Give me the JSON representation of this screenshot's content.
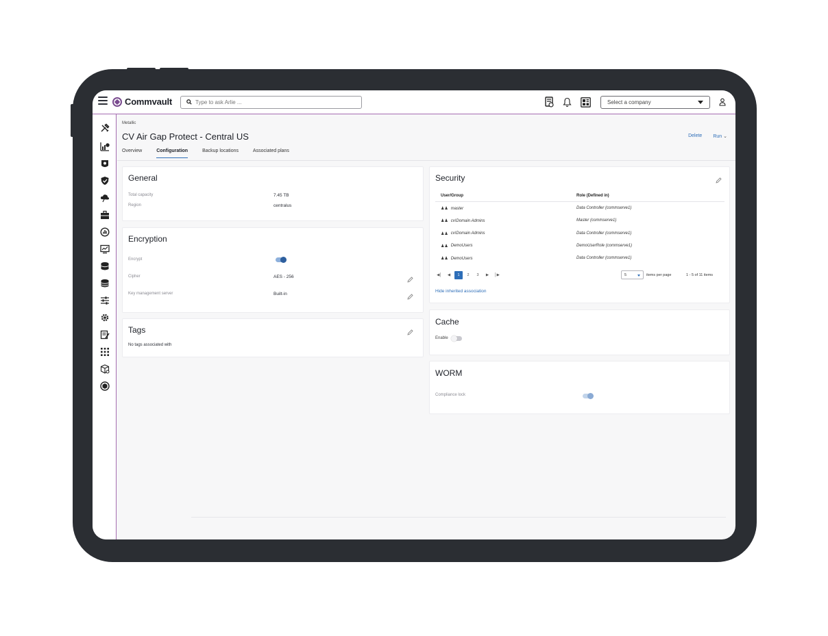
{
  "header": {
    "brand": "Commvault",
    "search_placeholder": "Type to ask Arlie ...",
    "company_select": "Select a company",
    "icons": [
      "hamburger-icon",
      "commvault-logo-icon",
      "search-icon",
      "report-icon",
      "bell-icon",
      "dashboard-icon",
      "user-icon"
    ]
  },
  "sidebar": {
    "items": [
      "tools-icon",
      "reports-icon",
      "guard-icon",
      "shield-icon",
      "cloud-icon",
      "briefcase-icon",
      "activity-icon",
      "monitor-icon",
      "storage-icon",
      "database-icon",
      "sliders-icon",
      "gear-icon",
      "jobs-icon",
      "apps-icon",
      "package-icon",
      "hub-icon"
    ]
  },
  "page": {
    "breadcrumb": "Metallic",
    "title": "CV Air Gap Protect - Central US",
    "actions": {
      "delete": "Delete",
      "run": "Run"
    },
    "tabs": [
      "Overview",
      "Configuration",
      "Backup locations",
      "Associated plans"
    ],
    "active_tab": "Configuration"
  },
  "general": {
    "title": "General",
    "rows": [
      {
        "label": "Total capacity",
        "value": "7.45 TB"
      },
      {
        "label": "Region",
        "value": "centralus"
      }
    ]
  },
  "encryption": {
    "title": "Encryption",
    "encrypt_label": "Encrypt",
    "encrypt_on": true,
    "cipher_label": "Cipher",
    "cipher_value": "AES - 256",
    "kms_label": "Key management server",
    "kms_value": "Built-in"
  },
  "tags": {
    "title": "Tags",
    "empty_text": "No tags associated with"
  },
  "security": {
    "title": "Security",
    "columns": [
      "User/Group",
      "Role (Defined in)"
    ],
    "rows": [
      {
        "user": "master",
        "role": "Data Controller (commserve1)"
      },
      {
        "user": "cv\\Domain Admins",
        "role": "Master (commserve1)"
      },
      {
        "user": "cv\\Domain Admins",
        "role": "Data Controller (commserve1)"
      },
      {
        "user": "DemoUsers",
        "role": "DemoUserRole (commserve1)"
      },
      {
        "user": "DemoUsers",
        "role": "Data Controller (commserve1)"
      }
    ],
    "pager": {
      "pages": [
        "1",
        "2",
        "3"
      ],
      "current": "1",
      "per_page": "5",
      "per_page_label": "items per page",
      "count": "1 - 5 of 11 items"
    },
    "hide_link": "Hide inherited association"
  },
  "cache": {
    "title": "Cache",
    "enable_label": "Enable",
    "enable_on": false
  },
  "worm": {
    "title": "WORM",
    "lock_label": "Compliance lock",
    "lock_on": true
  },
  "colors": {
    "accent": "#2e6eb8",
    "brand": "#7a4b8f",
    "frame": "#2b2e33"
  }
}
